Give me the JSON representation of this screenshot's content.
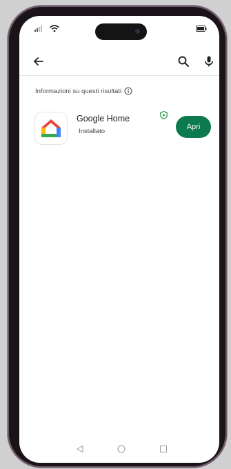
{
  "results_info": {
    "label": "Informazioni su questi risultati",
    "icon": "info-icon"
  },
  "app_result": {
    "name": "Google Home",
    "status": "Installato",
    "open_label": "Apri",
    "icon": "google-home-icon",
    "badge_icon": "play-protect-icon"
  },
  "top_bar": {
    "back_icon": "back-arrow-icon",
    "search_icon": "search-icon",
    "mic_icon": "mic-icon"
  },
  "status_bar": {
    "icons": [
      "signal-icon",
      "wifi-icon",
      "battery-icon"
    ]
  },
  "nav_bar": {
    "icons": [
      "nav-back-icon",
      "nav-home-icon",
      "nav-recents-icon"
    ]
  },
  "colors": {
    "accent_button": "#0d7a4d",
    "play_protect": "#1e8e3e",
    "screen_bg": "#ffffff"
  }
}
